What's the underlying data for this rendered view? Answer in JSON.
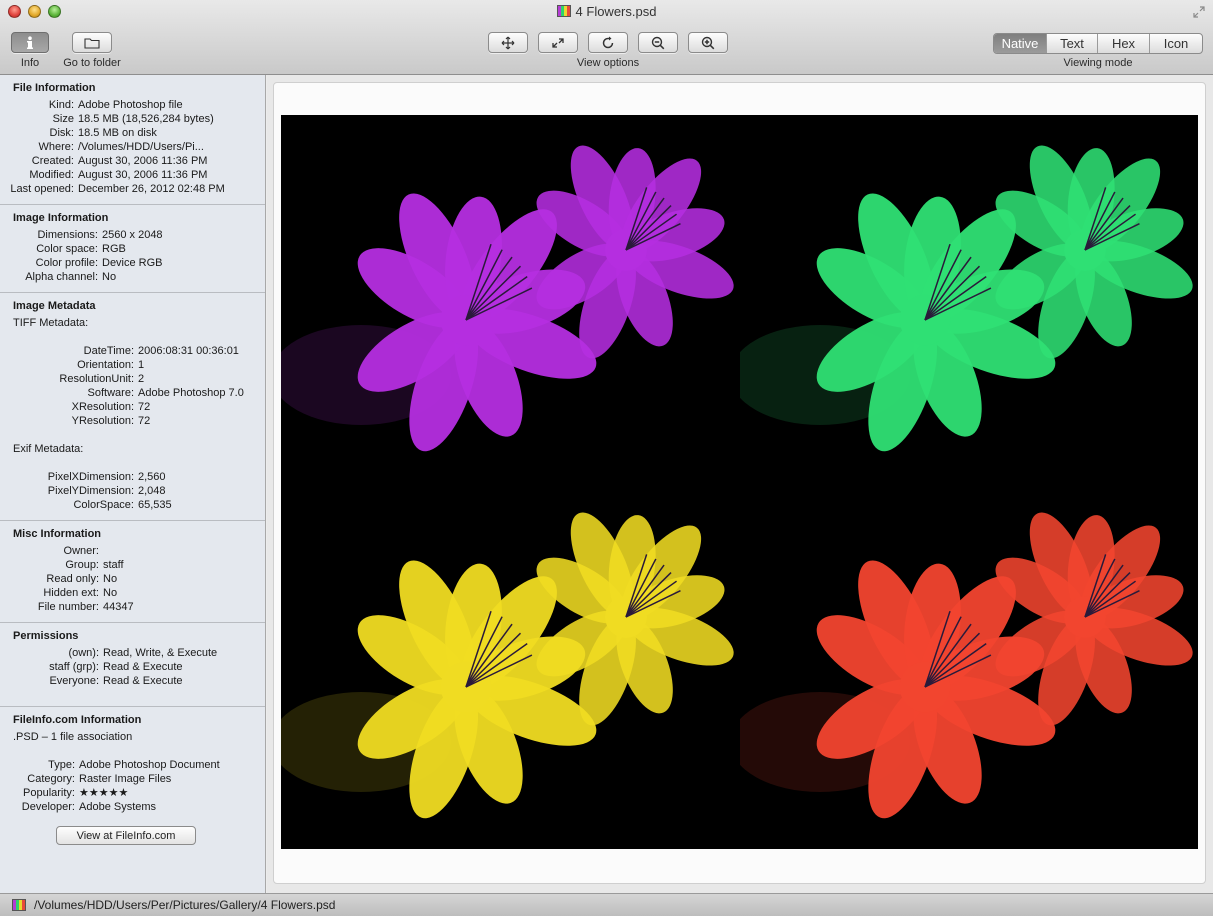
{
  "window": {
    "title": "4 Flowers.psd"
  },
  "toolbar": {
    "info_label": "Info",
    "folder_label": "Go to folder",
    "view_options_label": "View options",
    "viewing_mode_label": "Viewing mode",
    "modes": [
      "Native",
      "Text",
      "Hex",
      "Icon"
    ],
    "active_mode": "Native"
  },
  "file_info": {
    "heading": "File Information",
    "rows": [
      {
        "k": "Kind:",
        "v": "Adobe Photoshop file"
      },
      {
        "k": "Size",
        "v": "18.5 MB (18,526,284 bytes)"
      },
      {
        "k": "Disk:",
        "v": "18.5 MB on disk"
      },
      {
        "k": "Where:",
        "v": "/Volumes/HDD/Users/Pi..."
      },
      {
        "k": "Created:",
        "v": "August 30, 2006 11:36 PM"
      },
      {
        "k": "Modified:",
        "v": "August 30, 2006 11:36 PM"
      },
      {
        "k": "Last opened:",
        "v": "December 26, 2012 02:48 PM"
      }
    ]
  },
  "image_info": {
    "heading": "Image Information",
    "rows": [
      {
        "k": "Dimensions:",
        "v": "2560 x 2048"
      },
      {
        "k": "Color space:",
        "v": "RGB"
      },
      {
        "k": "Color profile:",
        "v": "Device RGB"
      },
      {
        "k": "Alpha channel:",
        "v": "No"
      }
    ]
  },
  "image_metadata": {
    "heading": "Image Metadata",
    "tiff_label": "TIFF Metadata:",
    "tiff_rows": [
      {
        "k": "DateTime:",
        "v": "2006:08:31 00:36:01"
      },
      {
        "k": "Orientation:",
        "v": "1"
      },
      {
        "k": "ResolutionUnit:",
        "v": "2"
      },
      {
        "k": "Software:",
        "v": "Adobe Photoshop 7.0"
      },
      {
        "k": "XResolution:",
        "v": "72"
      },
      {
        "k": "YResolution:",
        "v": "72"
      }
    ],
    "exif_label": "Exif Metadata:",
    "exif_rows": [
      {
        "k": "PixelXDimension:",
        "v": "2,560"
      },
      {
        "k": "PixelYDimension:",
        "v": "2,048"
      },
      {
        "k": "ColorSpace:",
        "v": "65,535"
      }
    ]
  },
  "misc_info": {
    "heading": "Misc Information",
    "rows": [
      {
        "k": "Owner:",
        "v": ""
      },
      {
        "k": "Group:",
        "v": "staff"
      },
      {
        "k": "Read only:",
        "v": "No"
      },
      {
        "k": "Hidden ext:",
        "v": "No"
      },
      {
        "k": "File number:",
        "v": "44347"
      }
    ]
  },
  "permissions": {
    "heading": "Permissions",
    "rows": [
      {
        "k": "(own):",
        "v": "Read, Write, & Execute"
      },
      {
        "k": "staff (grp):",
        "v": "Read & Execute"
      },
      {
        "k": "Everyone:",
        "v": "Read & Execute"
      }
    ]
  },
  "fileinfo": {
    "heading": "FileInfo.com Information",
    "association": ".PSD – 1 file association",
    "rows": [
      {
        "k": "Type:",
        "v": "Adobe Photoshop Document"
      },
      {
        "k": "Category:",
        "v": "Raster Image Files"
      },
      {
        "k": "Popularity:",
        "v": "★★★★★"
      },
      {
        "k": "Developer:",
        "v": "Adobe Systems"
      }
    ],
    "button_label": "View at FileInfo.com"
  },
  "statusbar": {
    "path": "/Volumes/HDD/Users/Per/Pictures/Gallery/4 Flowers.psd"
  },
  "preview": {
    "flower_colors": [
      "#b52ee0",
      "#2fe074",
      "#f0dc22",
      "#f2452f"
    ]
  }
}
